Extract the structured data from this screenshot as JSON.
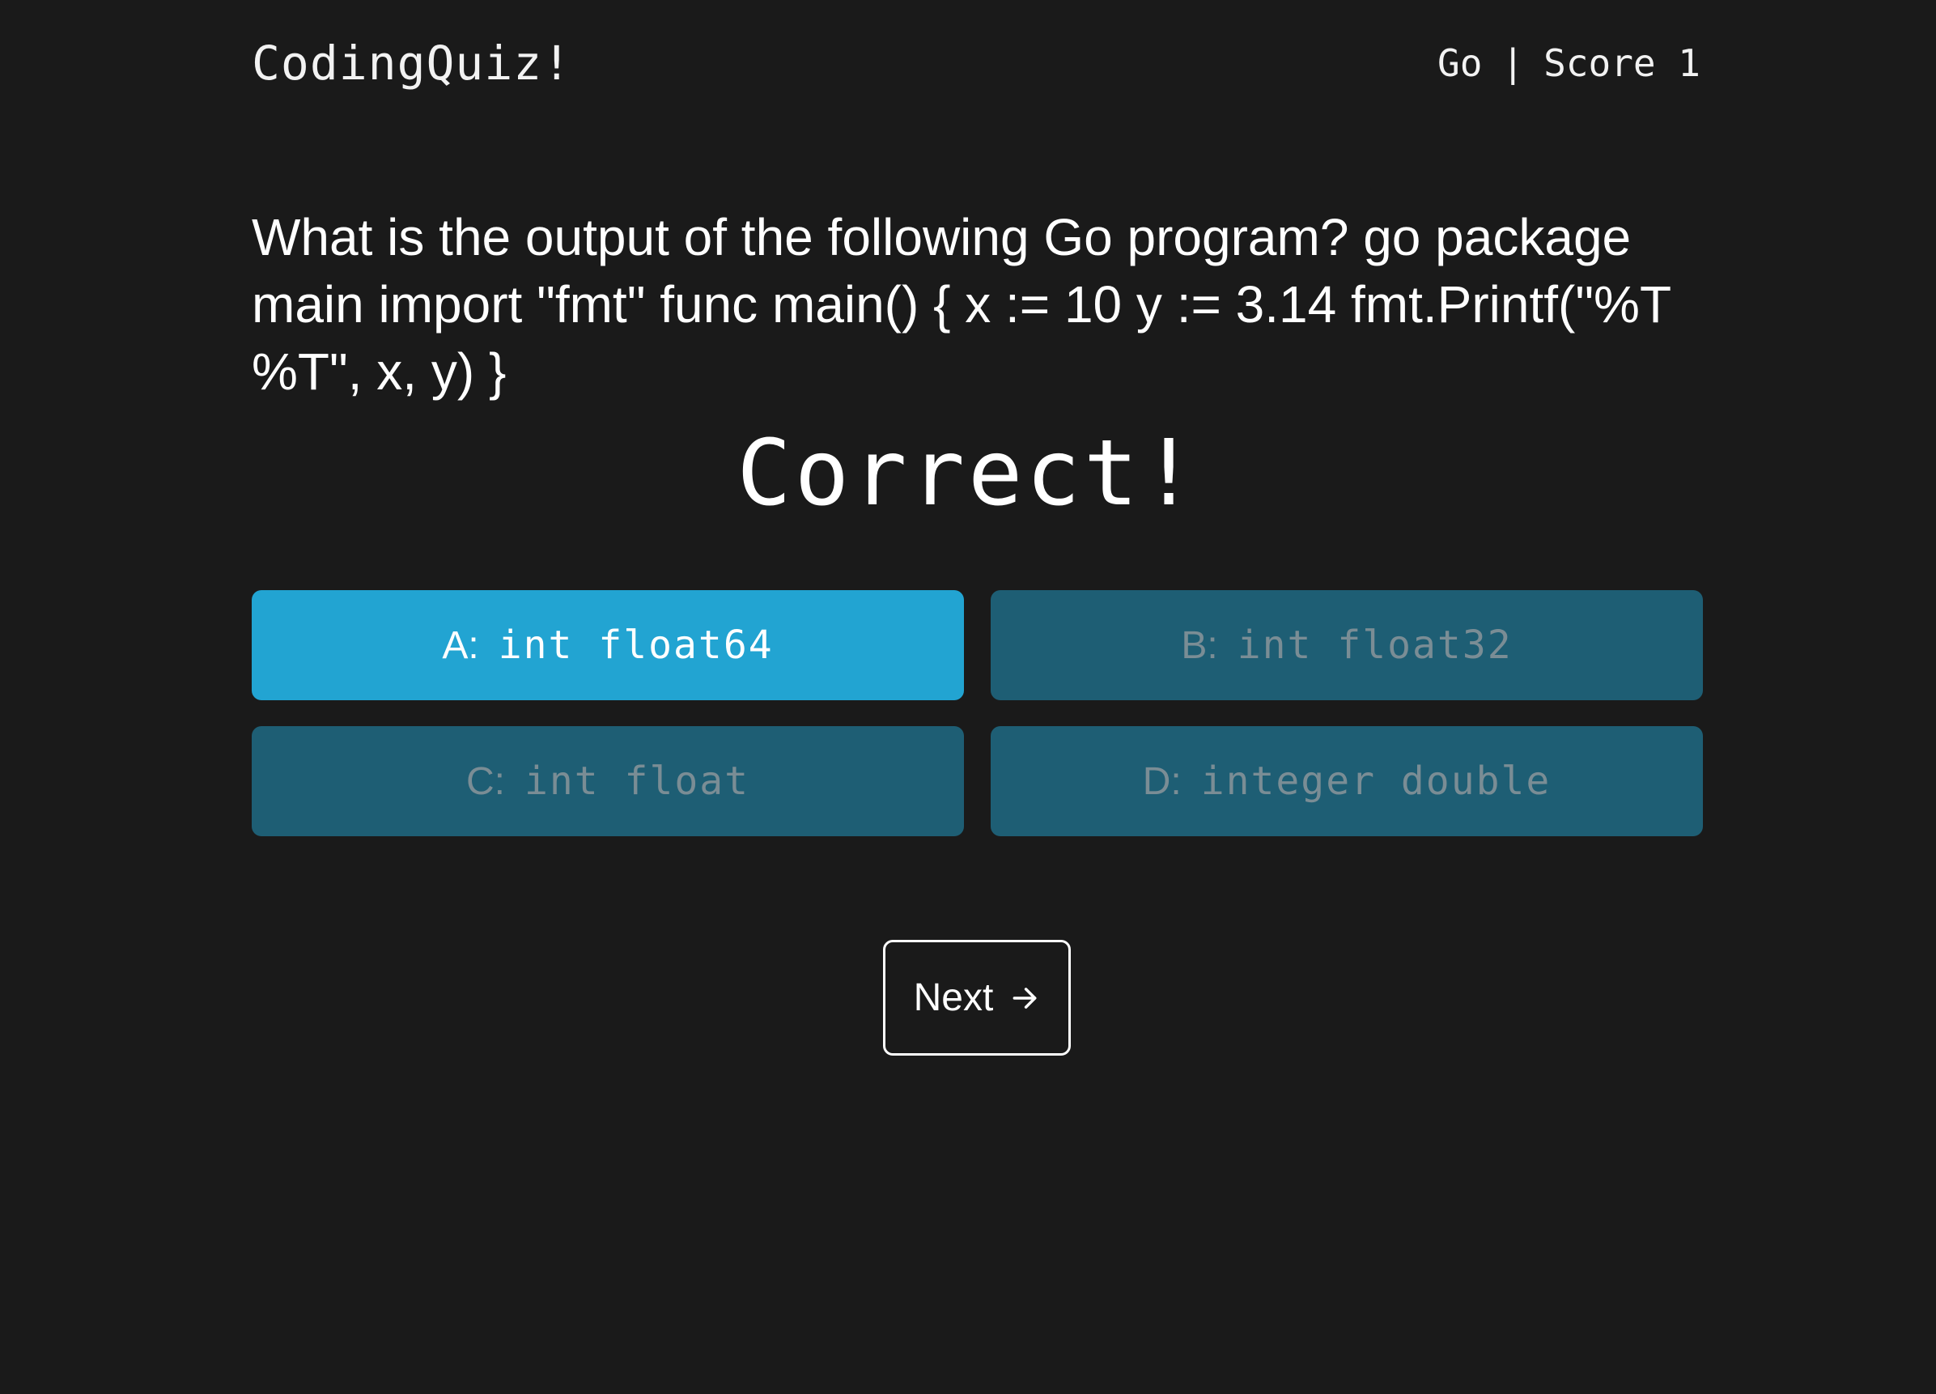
{
  "header": {
    "brand": "CodingQuiz!",
    "language": "Go",
    "separator": "|",
    "score_label": "Score",
    "score_value": "1"
  },
  "question": {
    "text": "What is the output of the following Go program? go package main import \"fmt\" func main() { x := 10 y := 3.14 fmt.Printf(\"%T %T\", x, y) }"
  },
  "result": {
    "message": "Correct!"
  },
  "answers": [
    {
      "letter": "A:",
      "text": "int float64",
      "state": "correct"
    },
    {
      "letter": "B:",
      "text": "int float32",
      "state": "disabled"
    },
    {
      "letter": "C:",
      "text": "int float",
      "state": "disabled"
    },
    {
      "letter": "D:",
      "text": "integer double",
      "state": "disabled"
    }
  ],
  "next": {
    "label": "Next",
    "icon": "arrow-right-icon"
  },
  "colors": {
    "background": "#1a1a1a",
    "correct_answer": "#22a4d2",
    "other_answer": "#1e5e74"
  }
}
